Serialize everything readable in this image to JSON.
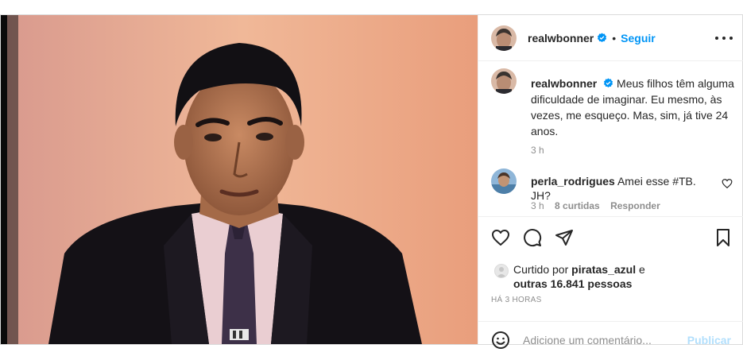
{
  "post": {
    "username": "realwbonner",
    "follow_label": "Seguir",
    "dot": "•",
    "caption_text": "Meus filhos têm alguma dificuldade de imaginar. Eu mesmo, às vezes, me esqueço. Mas, sim, já tive 24 anos.",
    "caption_time": "3 h",
    "photo_alt": "Foto antiga de apresentador de terno escuro e gravata em estúdio de TV"
  },
  "comment": {
    "username": "perla_rodrigues",
    "text": "Amei esse #TB. JH?",
    "time": "3 h",
    "likes": "8 curtidas",
    "reply_label": "Responder"
  },
  "likes": {
    "prefix": "Curtido por",
    "user": "piratas_azul",
    "joiner": "e",
    "others": "outras 16.841 pessoas"
  },
  "timestamp": "HÁ 3 HORAS",
  "composer": {
    "placeholder": "Adicione um comentário...",
    "publish_label": "Publicar"
  },
  "colors": {
    "accent": "#0095f6",
    "publish_disabled": "#b2dffc",
    "muted": "#8e8e8e",
    "text": "#262626"
  }
}
